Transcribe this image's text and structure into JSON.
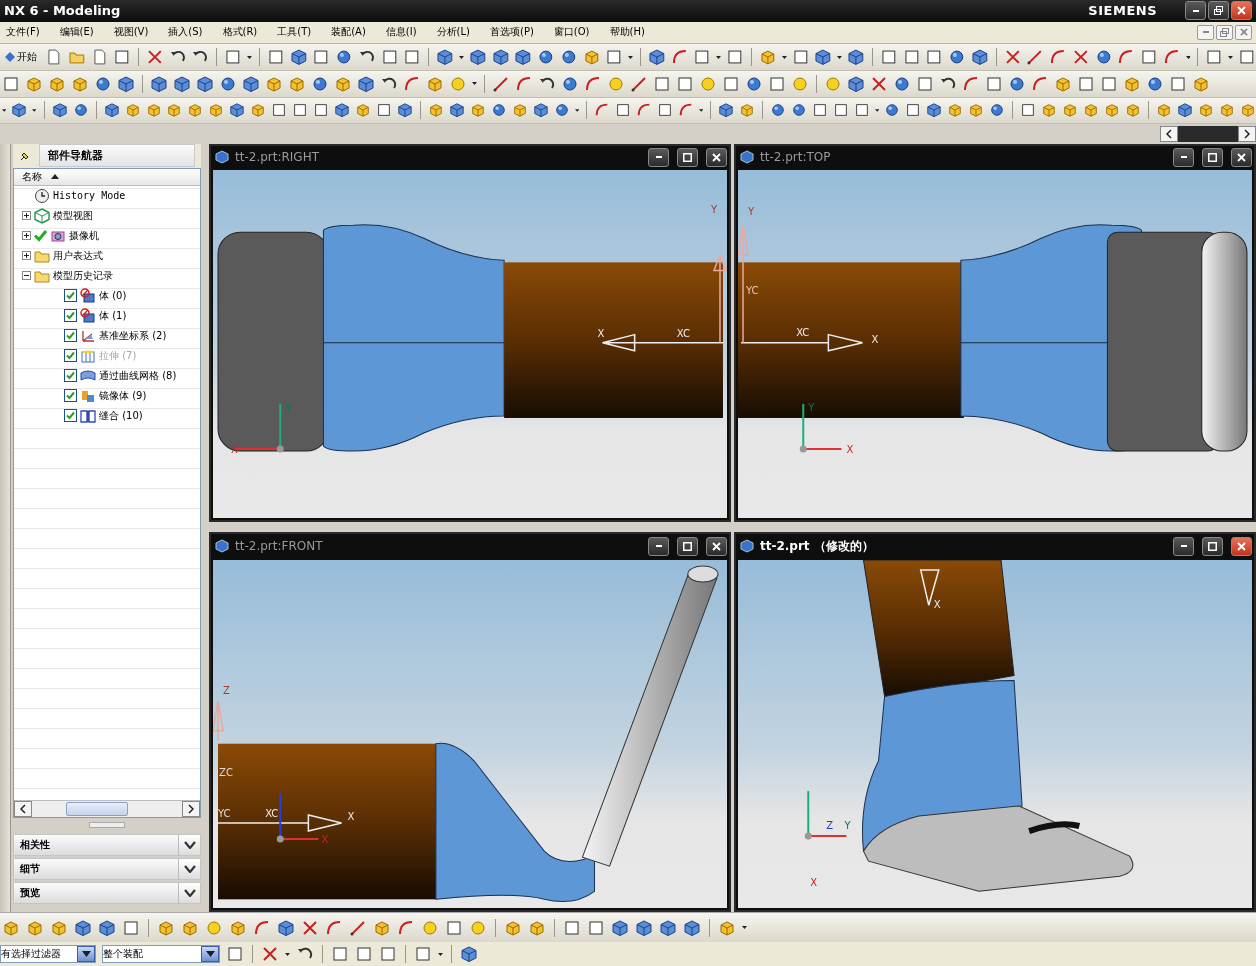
{
  "window": {
    "title": "NX 6 - Modeling",
    "brand": "SIEMENS"
  },
  "menu": [
    "文件(F)",
    "编辑(E)",
    "视图(V)",
    "插入(S)",
    "格式(R)",
    "工具(T)",
    "装配(A)",
    "信息(I)",
    "分析(L)",
    "首选项(P)",
    "窗口(O)",
    "帮助(H)"
  ],
  "toolbar": {
    "start_label": "开始"
  },
  "navigator": {
    "title": "部件导航器",
    "column": "名称",
    "tree": [
      {
        "label": "History Mode",
        "kind": "clock",
        "checked": false,
        "dimmed": false
      },
      {
        "label": "模型视图",
        "kind": "views",
        "expanded": false,
        "checked": false,
        "dimmed": false
      },
      {
        "label": "摄像机",
        "kind": "camera",
        "expanded": false,
        "checked": true,
        "dimmed": false
      },
      {
        "label": "用户表达式",
        "kind": "folder",
        "expanded": false,
        "checked": false,
        "dimmed": false
      },
      {
        "label": "模型历史记录",
        "kind": "folder",
        "expanded": true,
        "checked": false,
        "dimmed": false,
        "children": [
          {
            "label": "体 (0)",
            "kind": "body",
            "checked": true,
            "dimmed": false
          },
          {
            "label": "体 (1)",
            "kind": "body",
            "checked": true,
            "dimmed": false
          },
          {
            "label": "基准坐标系 (2)",
            "kind": "datum",
            "checked": true,
            "dimmed": false
          },
          {
            "label": "拉伸 (7)",
            "kind": "extrude",
            "checked": true,
            "dimmed": true
          },
          {
            "label": "通过曲线网格 (8)",
            "kind": "mesh",
            "checked": true,
            "dimmed": false
          },
          {
            "label": "镜像体 (9)",
            "kind": "mirror",
            "checked": true,
            "dimmed": false
          },
          {
            "label": "缝合 (10)",
            "kind": "sew",
            "checked": true,
            "dimmed": false
          }
        ]
      }
    ],
    "sections": [
      {
        "label": "相关性",
        "expanded": false
      },
      {
        "label": "细节",
        "expanded": false
      },
      {
        "label": "预览",
        "expanded": false
      }
    ]
  },
  "viewports": [
    {
      "title": "tt-2.prt:RIGHT",
      "kind": "right",
      "active": false,
      "labels": [
        "X",
        "XC",
        "Y",
        "Y",
        "X"
      ]
    },
    {
      "title": "tt-2.prt:TOP",
      "kind": "top",
      "active": false,
      "labels": [
        "Y",
        "YC",
        "XC",
        "X",
        "Y",
        "X"
      ]
    },
    {
      "title": "tt-2.prt:FRONT",
      "kind": "front",
      "active": false,
      "labels": [
        "Z",
        "ZC",
        "YC",
        "XC",
        "X",
        "X"
      ]
    },
    {
      "title": "tt-2.prt （修改的）",
      "kind": "iso",
      "active": true,
      "labels": [
        "X",
        "Z",
        "Y",
        "X"
      ]
    }
  ],
  "status_bar": {
    "filter": "有选择过滤器",
    "scope": "整个装配"
  }
}
